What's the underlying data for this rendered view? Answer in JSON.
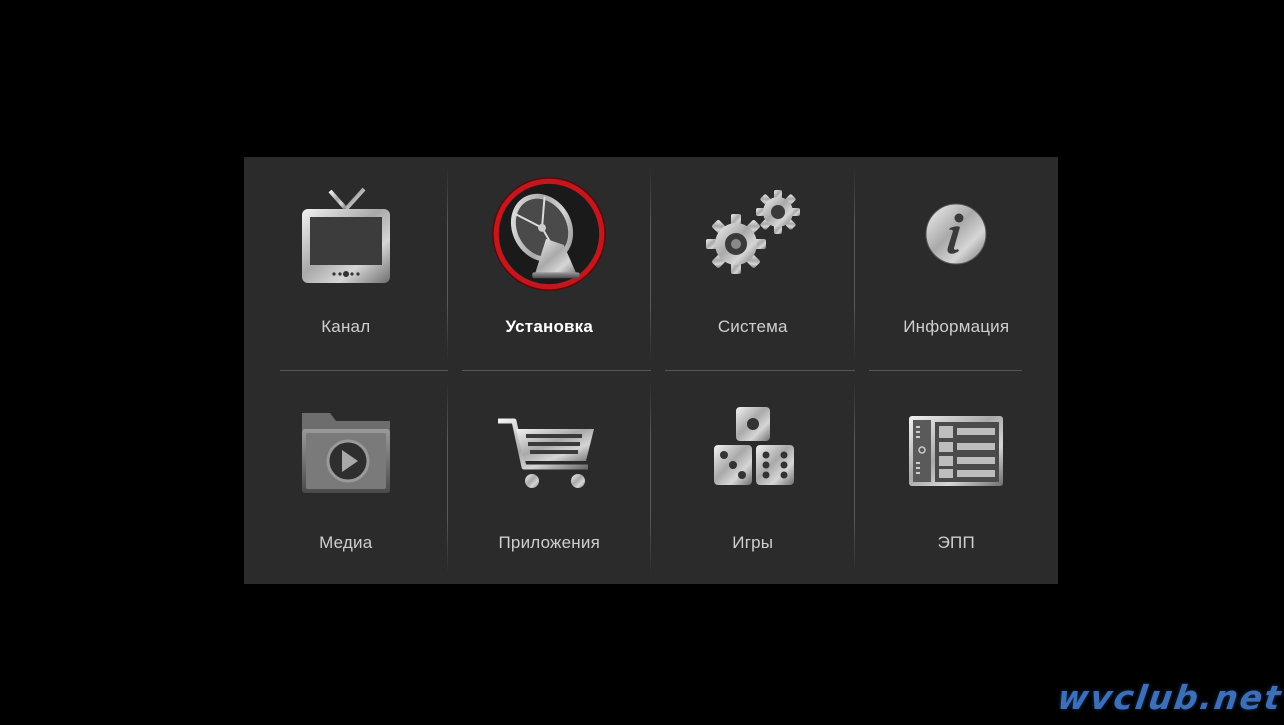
{
  "menu": {
    "selected": "setup",
    "items": [
      {
        "id": "channel",
        "label": "Канал",
        "icon": "tv-icon"
      },
      {
        "id": "setup",
        "label": "Установка",
        "icon": "satellite-dish-icon"
      },
      {
        "id": "system",
        "label": "Система",
        "icon": "gears-icon"
      },
      {
        "id": "info",
        "label": "Информация",
        "icon": "info-icon"
      },
      {
        "id": "media",
        "label": "Медиа",
        "icon": "media-folder-icon"
      },
      {
        "id": "apps",
        "label": "Приложения",
        "icon": "shopping-cart-icon"
      },
      {
        "id": "games",
        "label": "Игры",
        "icon": "dice-icon"
      },
      {
        "id": "epg",
        "label": "ЭПП",
        "icon": "epg-guide-icon"
      }
    ]
  },
  "watermark": {
    "text": "wvclub.net",
    "color": "#3d6fb8"
  },
  "colors": {
    "panel_bg": "#2b2b2b",
    "background": "#000000",
    "selection_ring": "#b5121b",
    "label": "#cfcfcf",
    "label_selected": "#ffffff"
  }
}
